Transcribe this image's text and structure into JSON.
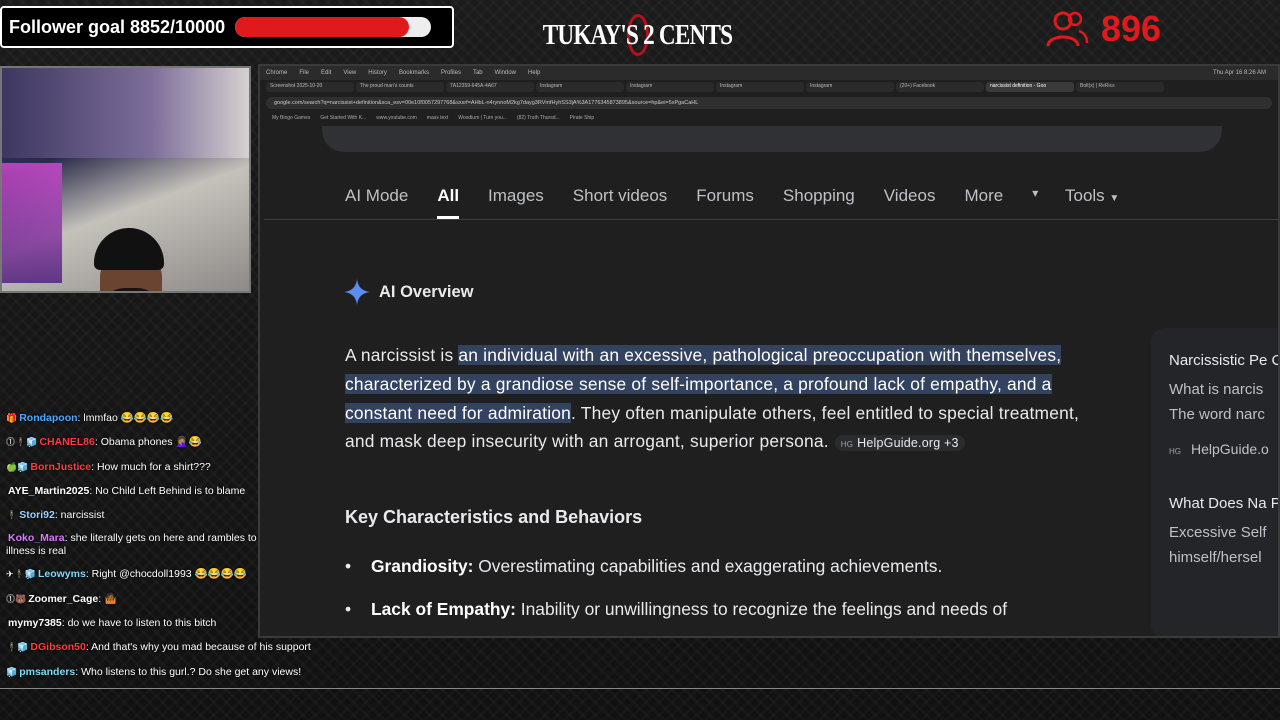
{
  "overlay": {
    "follower_goal_text": "Follower goal 8852/10000",
    "goal_progress": 0.885,
    "logo_text": "TUKAY'S 2 CENTS",
    "viewer_count": "896",
    "accent_color": "#e0191c"
  },
  "chat": [
    {
      "badges": "🎁",
      "user": "Rondapoon",
      "user_color": "#4fa8ff",
      "text": "lmmfao 😂😂😂😂"
    },
    {
      "badges": "⓵🕴🧊",
      "user": "CHANEL86",
      "user_color": "#ff3b3b",
      "text": "Obama phones 🤦🏽‍♀️😂"
    },
    {
      "badges": "🍏🧊",
      "user": "BornJustice",
      "user_color": "#ff3b3b",
      "text": "How much for a shirt???"
    },
    {
      "badges": "",
      "user": "AYE_Martin2025",
      "user_color": "#ffffff",
      "text": "No Child Left Behind is to blame"
    },
    {
      "badges": "🕴",
      "user": "Stori92",
      "user_color": "#9ad1ff",
      "text": "narcissist"
    },
    {
      "badges": "",
      "user": "Koko_Mara",
      "user_color": "#d97bff",
      "text": "she literally gets on here and rambles to herself! mental illness is real",
      "wrap": true
    },
    {
      "badges": "✈🕴🧊",
      "user": "Leowyms",
      "user_color": "#7fd9ff",
      "text": "Right @chocdoll1993 😂😂😂😂"
    },
    {
      "badges": "⓵🐻",
      "user": "Zoomer_Cage",
      "user_color": "#ffffff",
      "text": "🤷🏾"
    },
    {
      "badges": "",
      "user": "mymy7385",
      "user_color": "#ffffff",
      "text": "do we have to listen to this bitch"
    },
    {
      "badges": "🕴🧊",
      "user": "DGibson50",
      "user_color": "#ff3b3b",
      "text": "And that's why you mad because of his support"
    },
    {
      "badges": "🧊",
      "user": "pmsanders",
      "user_color": "#7fd9ff",
      "text": "Who listens to this gurl.? Do she get any views!"
    }
  ],
  "browser": {
    "mac_menu": [
      "Chrome",
      "File",
      "Edit",
      "View",
      "History",
      "Bookmarks",
      "Profiles",
      "Tab",
      "Window",
      "Help"
    ],
    "mac_clock": "Thu Apr 16 8:26 AM",
    "tabs": [
      "Screenshot 2025-10-20",
      "The proud man's counts",
      "7A12359-645A-4A67",
      "Instagram",
      "Instagram",
      "Instagram",
      "Instagram",
      "(20+) Facebook",
      "narcissist definition - Goo",
      "Bolt(x) | ReRics"
    ],
    "active_tab_index": 8,
    "url": "google.com/search?q=narcissist+definition&sca_esv=00e10f0057297768&sxsrf=AHbL-n4rynnoM2kg7dayg3RVmfHyhSS3jA%3A1776345873895&source=hp&ei=5xPgaCaHL",
    "bookmarks": [
      "My Bingo Games",
      "Get Started With K...",
      "www.youtube.com",
      "mass text",
      "Woodium | Turn you...",
      "(82) Truth Thursd...",
      "Pirate Ship"
    ],
    "search_tabs": [
      "AI Mode",
      "All",
      "Images",
      "Short videos",
      "Forums",
      "Shopping",
      "Videos",
      "More"
    ],
    "active_search_tab": "All",
    "tools_label": "Tools",
    "ai_overview_title": "AI Overview",
    "ai_intro": "A narcissist is ",
    "ai_highlight": "an individual with an excessive, pathological preoccupation with themselves, characterized by a grandiose sense of self-importance, a profound lack of empathy, and a constant need for admiration",
    "ai_rest": ". They often manipulate others, feel entitled to special treatment, and mask deep insecurity with an arrogant, superior persona.",
    "source_chip": "HelpGuide.org +3",
    "key_heading": "Key Characteristics and Behaviors",
    "bullets": [
      {
        "term": "Grandiosity:",
        "text": " Overestimating capabilities and exaggerating achievements."
      },
      {
        "term": "Lack of Empathy:",
        "text": " Inability or unwillingness to recognize the feelings and needs of"
      }
    ],
    "side_panel": {
      "card1_title": "Narcissistic Pe Causes, Help",
      "card1_snippet_1": "What is narcis",
      "card1_snippet_2": "The word narc",
      "card1_source": "HelpGuide.o",
      "card2_title": "What Does Na Personality Dis",
      "card2_snippet_1": "Excessive Self",
      "card2_snippet_2": "himself/hersel"
    }
  }
}
